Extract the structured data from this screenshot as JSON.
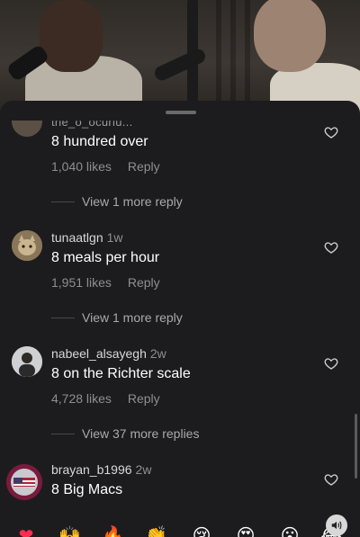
{
  "comments": [
    {
      "username": "the_o_ocuriu...",
      "text": "8 hundred over",
      "likes": "1,040 likes",
      "reply_label": "Reply",
      "view_more": "View 1 more reply"
    },
    {
      "username": "tunaatlgn",
      "time": "1w",
      "text": "8 meals per hour",
      "likes": "1,951 likes",
      "reply_label": "Reply",
      "view_more": "View 1 more reply"
    },
    {
      "username": "nabeel_alsayegh",
      "time": "2w",
      "text": "8 on the Richter scale",
      "likes": "4,728 likes",
      "reply_label": "Reply",
      "view_more": "View 37 more replies"
    },
    {
      "username": "brayan_b1996",
      "time": "2w",
      "text": "8 Big Macs"
    }
  ],
  "emoji_bar": [
    {
      "name": "red-heart",
      "glyph": "❤"
    },
    {
      "name": "raising-hands",
      "glyph": "🙌"
    },
    {
      "name": "fire",
      "glyph": "🔥"
    },
    {
      "name": "clapping-hands",
      "glyph": "👏"
    },
    {
      "name": "crying-face",
      "glyph": "😢"
    },
    {
      "name": "heart-eyes",
      "glyph": "😍"
    },
    {
      "name": "surprised-face",
      "glyph": "😮"
    },
    {
      "name": "laughing-face",
      "glyph": "😂"
    }
  ],
  "colors": {
    "background": "#1c1c1e",
    "secondary_text": "#8e8e93",
    "primary_text": "#ffffff"
  }
}
